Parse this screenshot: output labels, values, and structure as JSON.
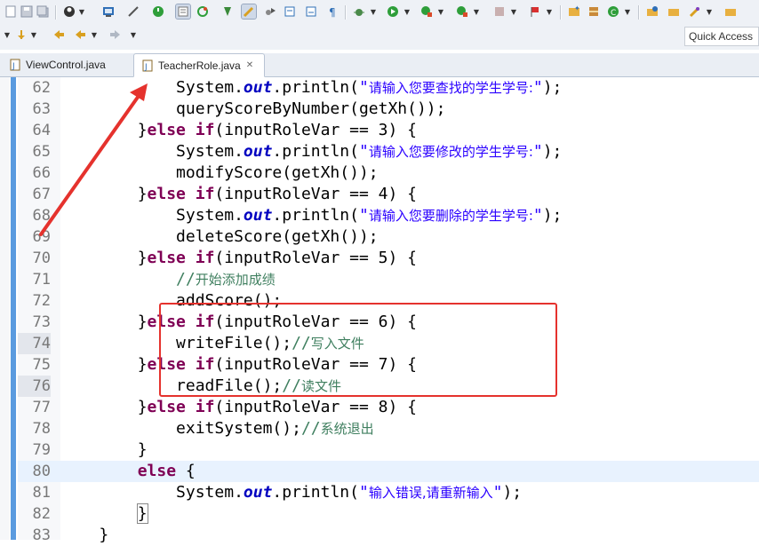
{
  "toolbar": {
    "quick_access_placeholder": "Quick Access"
  },
  "tabs": [
    {
      "label": "ViewControl.java",
      "active": false
    },
    {
      "label": "TeacherRole.java",
      "active": true,
      "close": "✕"
    }
  ],
  "colors": {
    "keyword": "#7f0055",
    "string": "#2a00ff",
    "comment": "#3f7f5f",
    "field": "#0000c0",
    "annotation": "#e5322d",
    "current_line": "#e8f2fe"
  },
  "editor": {
    "current_line": 80,
    "lines": [
      {
        "n": "62",
        "segs": [
          [
            "p",
            "            System."
          ],
          [
            "fld",
            "out"
          ],
          [
            "p",
            ".println("
          ],
          [
            "str",
            "\""
          ],
          [
            "strcn",
            "请输入您要查找的学生学号:"
          ],
          [
            "str",
            "\""
          ],
          [
            "p",
            ");"
          ]
        ]
      },
      {
        "n": "63",
        "segs": [
          [
            "p",
            "            queryScoreByNumber(getXh());"
          ]
        ]
      },
      {
        "n": "64",
        "segs": [
          [
            "p",
            "        }"
          ],
          [
            "kw",
            "else if"
          ],
          [
            "p",
            "(inputRoleVar == 3) {"
          ]
        ]
      },
      {
        "n": "65",
        "segs": [
          [
            "p",
            "            System."
          ],
          [
            "fld",
            "out"
          ],
          [
            "p",
            ".println("
          ],
          [
            "str",
            "\""
          ],
          [
            "strcn",
            "请输入您要修改的学生学号:"
          ],
          [
            "str",
            "\""
          ],
          [
            "p",
            ");"
          ]
        ]
      },
      {
        "n": "66",
        "segs": [
          [
            "p",
            "            modifyScore(getXh());"
          ]
        ]
      },
      {
        "n": "67",
        "segs": [
          [
            "p",
            "        }"
          ],
          [
            "kw",
            "else if"
          ],
          [
            "p",
            "(inputRoleVar == 4) {"
          ]
        ]
      },
      {
        "n": "68",
        "segs": [
          [
            "p",
            "            System."
          ],
          [
            "fld",
            "out"
          ],
          [
            "p",
            ".println("
          ],
          [
            "str",
            "\""
          ],
          [
            "strcn",
            "请输入您要删除的学生学号:"
          ],
          [
            "str",
            "\""
          ],
          [
            "p",
            ");"
          ]
        ]
      },
      {
        "n": "69",
        "segs": [
          [
            "p",
            "            deleteScore(getXh());"
          ]
        ]
      },
      {
        "n": "70",
        "segs": [
          [
            "p",
            "        }"
          ],
          [
            "kw",
            "else if"
          ],
          [
            "p",
            "(inputRoleVar == 5) {"
          ]
        ]
      },
      {
        "n": "71",
        "segs": [
          [
            "p",
            "            "
          ],
          [
            "cmt",
            "//"
          ],
          [
            "cmtcn",
            "开始添加成绩"
          ]
        ]
      },
      {
        "n": "72",
        "segs": [
          [
            "p",
            "            addScore();"
          ]
        ]
      },
      {
        "n": "73",
        "segs": [
          [
            "p",
            "        }"
          ],
          [
            "kw",
            "else if"
          ],
          [
            "p",
            "(inputRoleVar == 6) {"
          ]
        ]
      },
      {
        "n": "74",
        "segs": [
          [
            "p",
            "            writeFile();"
          ],
          [
            "cmt",
            "//"
          ],
          [
            "cmtcn",
            "写入文件"
          ]
        ]
      },
      {
        "n": "75",
        "segs": [
          [
            "p",
            "        }"
          ],
          [
            "kw",
            "else if"
          ],
          [
            "p",
            "(inputRoleVar == 7) {"
          ]
        ]
      },
      {
        "n": "76",
        "segs": [
          [
            "p",
            "            readFile();"
          ],
          [
            "cmt",
            "//"
          ],
          [
            "cmtcn",
            "读文件"
          ]
        ]
      },
      {
        "n": "77",
        "segs": [
          [
            "p",
            "        }"
          ],
          [
            "kw",
            "else if"
          ],
          [
            "p",
            "(inputRoleVar == 8) {"
          ]
        ]
      },
      {
        "n": "78",
        "segs": [
          [
            "p",
            "            exitSystem();"
          ],
          [
            "cmt",
            "//"
          ],
          [
            "cmtcn",
            "系统退出"
          ]
        ]
      },
      {
        "n": "79",
        "segs": [
          [
            "p",
            "        }"
          ]
        ]
      },
      {
        "n": "80",
        "segs": [
          [
            "p",
            "        "
          ],
          [
            "kw",
            "else"
          ],
          [
            "p",
            " {"
          ]
        ]
      },
      {
        "n": "81",
        "segs": [
          [
            "p",
            "            System."
          ],
          [
            "fld",
            "out"
          ],
          [
            "p",
            ".println("
          ],
          [
            "str",
            "\""
          ],
          [
            "strcn",
            "输入错误,请重新输入"
          ],
          [
            "str",
            "\""
          ],
          [
            "p",
            ");"
          ]
        ]
      },
      {
        "n": "82",
        "segs": [
          [
            "p",
            "        "
          ],
          [
            "box",
            "}"
          ]
        ]
      },
      {
        "n": "83",
        "segs": [
          [
            "p",
            "    }"
          ]
        ]
      }
    ]
  }
}
